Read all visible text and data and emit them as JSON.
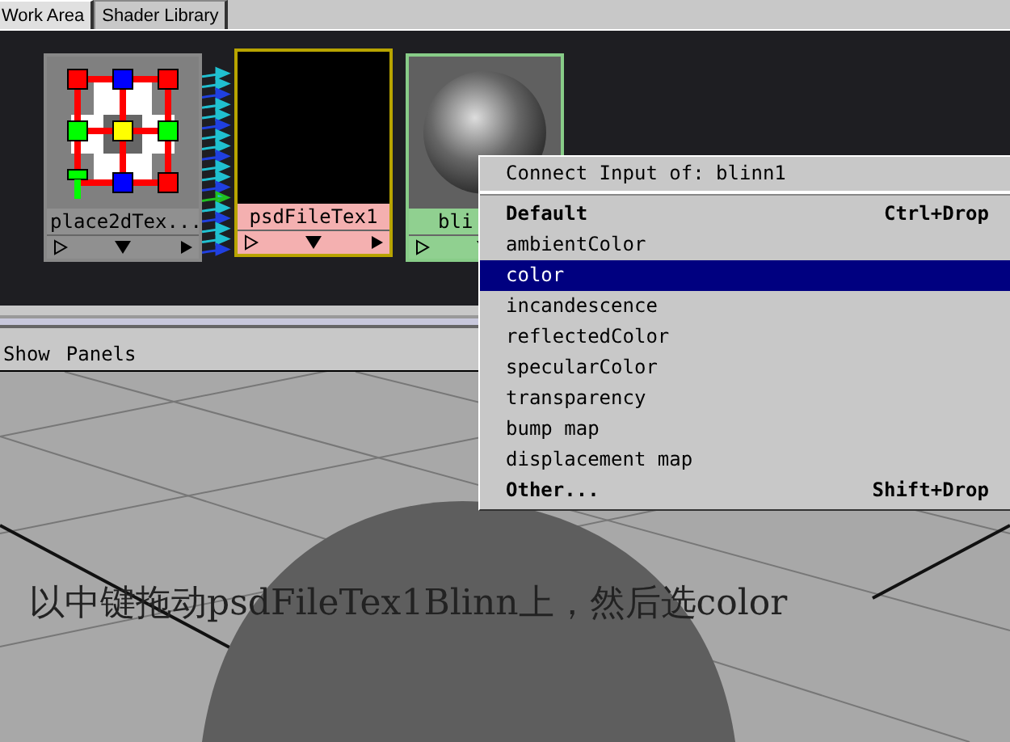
{
  "tabs": [
    {
      "label": "Work Area",
      "selected": true
    },
    {
      "label": "Shader Library",
      "selected": false
    }
  ],
  "nodes": [
    {
      "kind": "place2d",
      "label": "place2dTex...",
      "selected": false
    },
    {
      "kind": "file",
      "label": "psdFileTex1",
      "selected": true
    },
    {
      "kind": "shader",
      "label": "bli",
      "selected": false
    }
  ],
  "menu_bar": [
    "Show",
    "Panels"
  ],
  "popup": {
    "title": "Connect Input of: blinn1",
    "items": [
      {
        "label": "Default",
        "shortcut": "Ctrl+Drop",
        "bold": true,
        "selected": false
      },
      {
        "label": "ambientColor",
        "bold": false,
        "selected": false
      },
      {
        "label": "color",
        "bold": false,
        "selected": true
      },
      {
        "label": "incandescence",
        "bold": false,
        "selected": false
      },
      {
        "label": "reflectedColor",
        "bold": false,
        "selected": false
      },
      {
        "label": "specularColor",
        "bold": false,
        "selected": false
      },
      {
        "label": "transparency",
        "bold": false,
        "selected": false
      },
      {
        "label": "bump map",
        "bold": false,
        "selected": false
      },
      {
        "label": "displacement map",
        "bold": false,
        "selected": false
      },
      {
        "label": "Other...",
        "shortcut": "Shift+Drop",
        "bold": true,
        "selected": false
      }
    ]
  },
  "caption": "以中键拖动psdFileTex1Blinn上，然后选color"
}
